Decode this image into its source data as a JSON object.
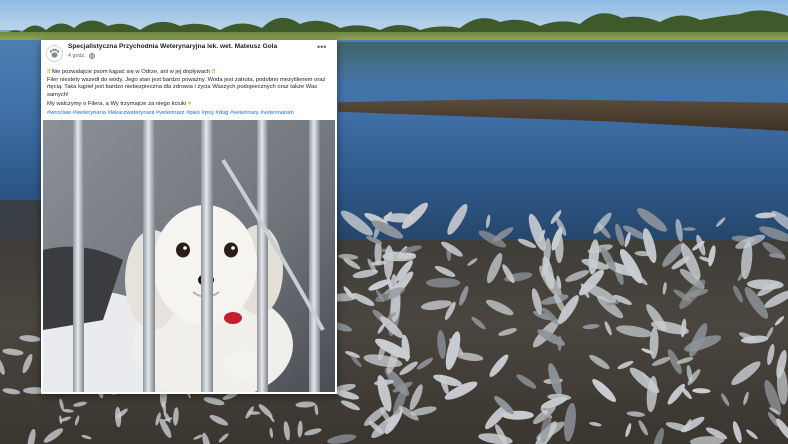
{
  "post": {
    "page_name": "Specjalistyczna Przychodnia Weterynaryjna lek. wet. Mateusz Gola",
    "time": "4 godz.",
    "warning_icon": "double-exclamation-icon",
    "text_lead_a": "Nie pozwalajcie psom kąpać się w Odrze, ani w jej dopływach",
    "text_lead_b": "Filer niestety wszedł do wody. Jego stan jest bardzo poważny. Woda jest zatruta, podobno mezytilenem oraz rtęcią. Taka kąpiel jest bardzo niebezpieczna dla zdrowia i życia Waszych podopiecznych oraz także Was samych!",
    "text_closing": "My walczymy o Filera, a Wy trzymajcie za niego kciuki",
    "hashtags": "#wroclaw #weterynaria #lekarzweterynarii #veterinarz #pies #psy #dog #veterinary #veterinarian",
    "photo_subject": "white-dog-behind-cage-bars"
  },
  "background": {
    "subject": "dead-fish-on-riverbank",
    "colors": {
      "sky": "#8fbbe4",
      "water": "#3f6fa5",
      "shore": "#4a463f",
      "fish": "#c9cdd2"
    }
  }
}
